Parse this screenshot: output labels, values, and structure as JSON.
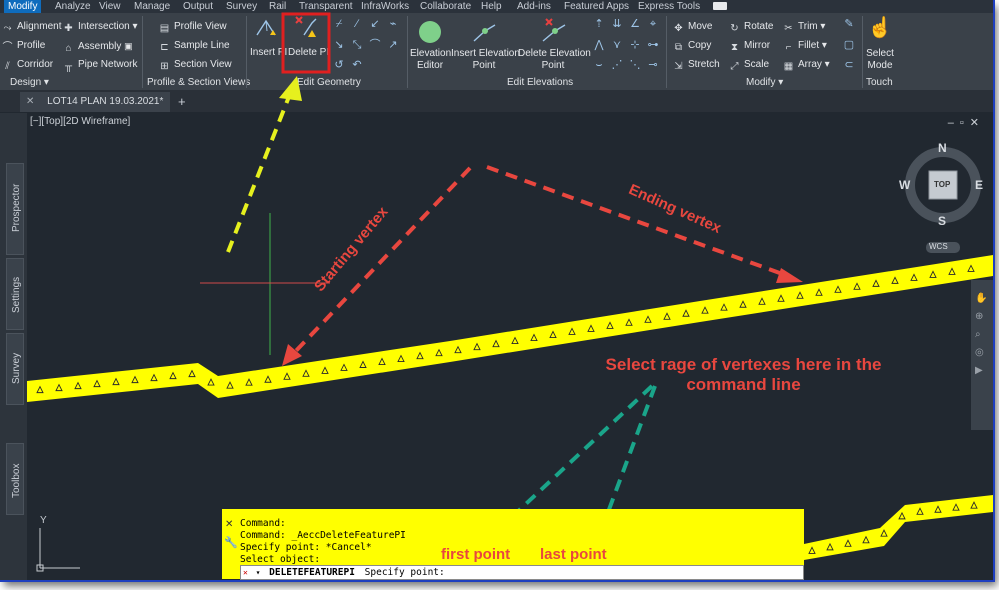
{
  "menu": [
    "Modify",
    "Analyze",
    "View",
    "Manage",
    "Output",
    "Survey",
    "Rail",
    "Transparent",
    "InfraWorks",
    "Collaborate",
    "Help",
    "Add-ins",
    "Featured Apps",
    "Express Tools"
  ],
  "ribbon": {
    "design": {
      "items": [
        "Alignment",
        "Profile",
        "Corridor",
        "Intersection",
        "Assembly",
        "Pipe Network"
      ],
      "label": "Design"
    },
    "profile_section": {
      "items": [
        "Profile View",
        "Sample Line",
        "Section View"
      ],
      "label": "Profile & Section Views"
    },
    "edit_geometry": {
      "insert_pi": "Insert PI",
      "delete_pi": "Delete PI",
      "label": "Edit Geometry"
    },
    "edit_elevations": {
      "elevation_editor": [
        "Elevation",
        "Editor"
      ],
      "insert_elevation_point": [
        "Insert Elevation",
        "Point"
      ],
      "delete_elevation_point": [
        "Delete Elevation",
        "Point"
      ],
      "label": "Edit Elevations"
    },
    "modify": {
      "items": [
        "Move",
        "Rotate",
        "Trim",
        "Copy",
        "Mirror",
        "Fillet",
        "Stretch",
        "Scale",
        "Array"
      ],
      "label": "Modify"
    },
    "touch": {
      "select_mode": [
        "Select",
        "Mode"
      ],
      "label": "Touch"
    }
  },
  "doc_tab": {
    "title": "LOT14 PLAN 19.03.2021*"
  },
  "viewport": {
    "label": "[−][Top][2D Wireframe]"
  },
  "side_tabs": [
    "Prospector",
    "Settings",
    "Survey",
    "Toolbox"
  ],
  "viewcube": {
    "n": "N",
    "s": "S",
    "e": "E",
    "w": "W",
    "top": "TOP",
    "wcs": "WCS"
  },
  "ucs": {
    "y": "Y"
  },
  "command_history": [
    "Command:",
    "Command: _AeccDeleteFeaturePI",
    "Specify point: *Cancel*",
    "Select object:"
  ],
  "command_input": {
    "command": "DELETEFEATUREPI",
    "prompt": "Specify point:"
  },
  "annotations": {
    "starting_vertex": "Starting vertex",
    "ending_vertex": "Ending vertex",
    "select_range": [
      "Select rage of vertexes here in the",
      "command line"
    ],
    "first_point": "first point",
    "last_point": "last point"
  },
  "colors": {
    "highlight": "#ffff00",
    "red_arrow": "#e8473f",
    "green_arrow": "#1aa58a",
    "box": "#e02020"
  }
}
